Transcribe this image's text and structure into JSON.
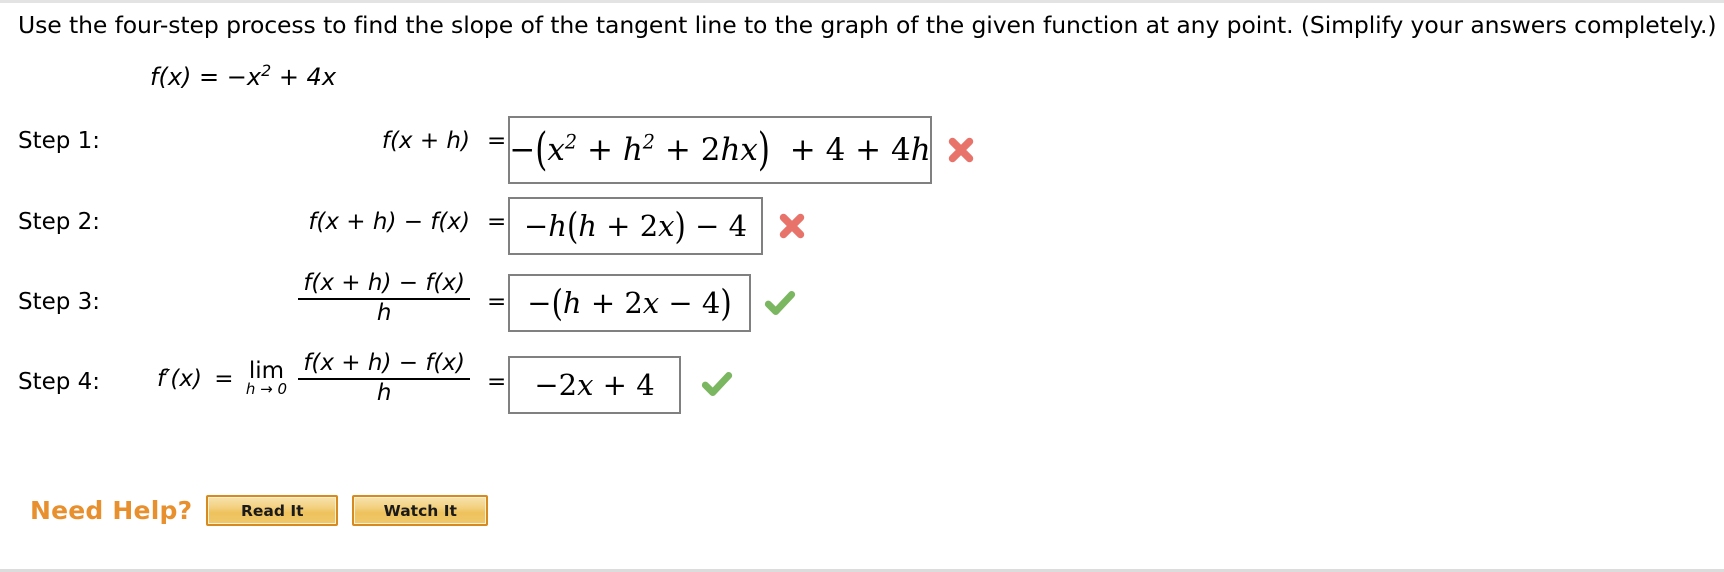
{
  "problem": {
    "prompt": "Use the four-step process to find the slope of the tangent line to the graph of the given function at any point. (Simplify your answers completely.)",
    "function_label": "f(x)",
    "function_eq": "=",
    "function_body_pre": "−x",
    "function_exp": "2",
    "function_body_post": "+ 4x"
  },
  "steps": [
    {
      "label": "Step 1:",
      "lhs": "f(x + h)",
      "equals": "=",
      "answer": "−(x² + h² + 2hx) + 4 + 4h",
      "status": "incorrect",
      "status_icon": "red-x-icon"
    },
    {
      "label": "Step 2:",
      "lhs": "f(x + h) − f(x)",
      "equals": "=",
      "answer": "−h(h + 2x) − 4",
      "status": "incorrect",
      "status_icon": "red-x-icon"
    },
    {
      "label": "Step 3:",
      "lhs_numerator": "f(x + h) − f(x)",
      "lhs_denominator": "h",
      "equals": "=",
      "answer": "−(h + 2x − 4)",
      "status": "correct",
      "status_icon": "green-check-icon"
    },
    {
      "label": "Step 4:",
      "lhs_prefix": "f′(x)",
      "prefix_equals": "=",
      "limit_word": "lim",
      "limit_sub": "h → 0",
      "lhs_numerator": "f(x + h) − f(x)",
      "lhs_denominator": "h",
      "equals": "=",
      "answer": "−2x + 4",
      "status": "correct",
      "status_icon": "green-check-icon"
    }
  ],
  "help": {
    "label": "Need Help?",
    "read_button": "Read It",
    "watch_button": "Watch It"
  },
  "colors": {
    "need_help_orange": "#e8902e",
    "button_border": "#d78a20",
    "incorrect_red": "#e8736a",
    "correct_green": "#7bb661",
    "box_border": "#808080"
  }
}
